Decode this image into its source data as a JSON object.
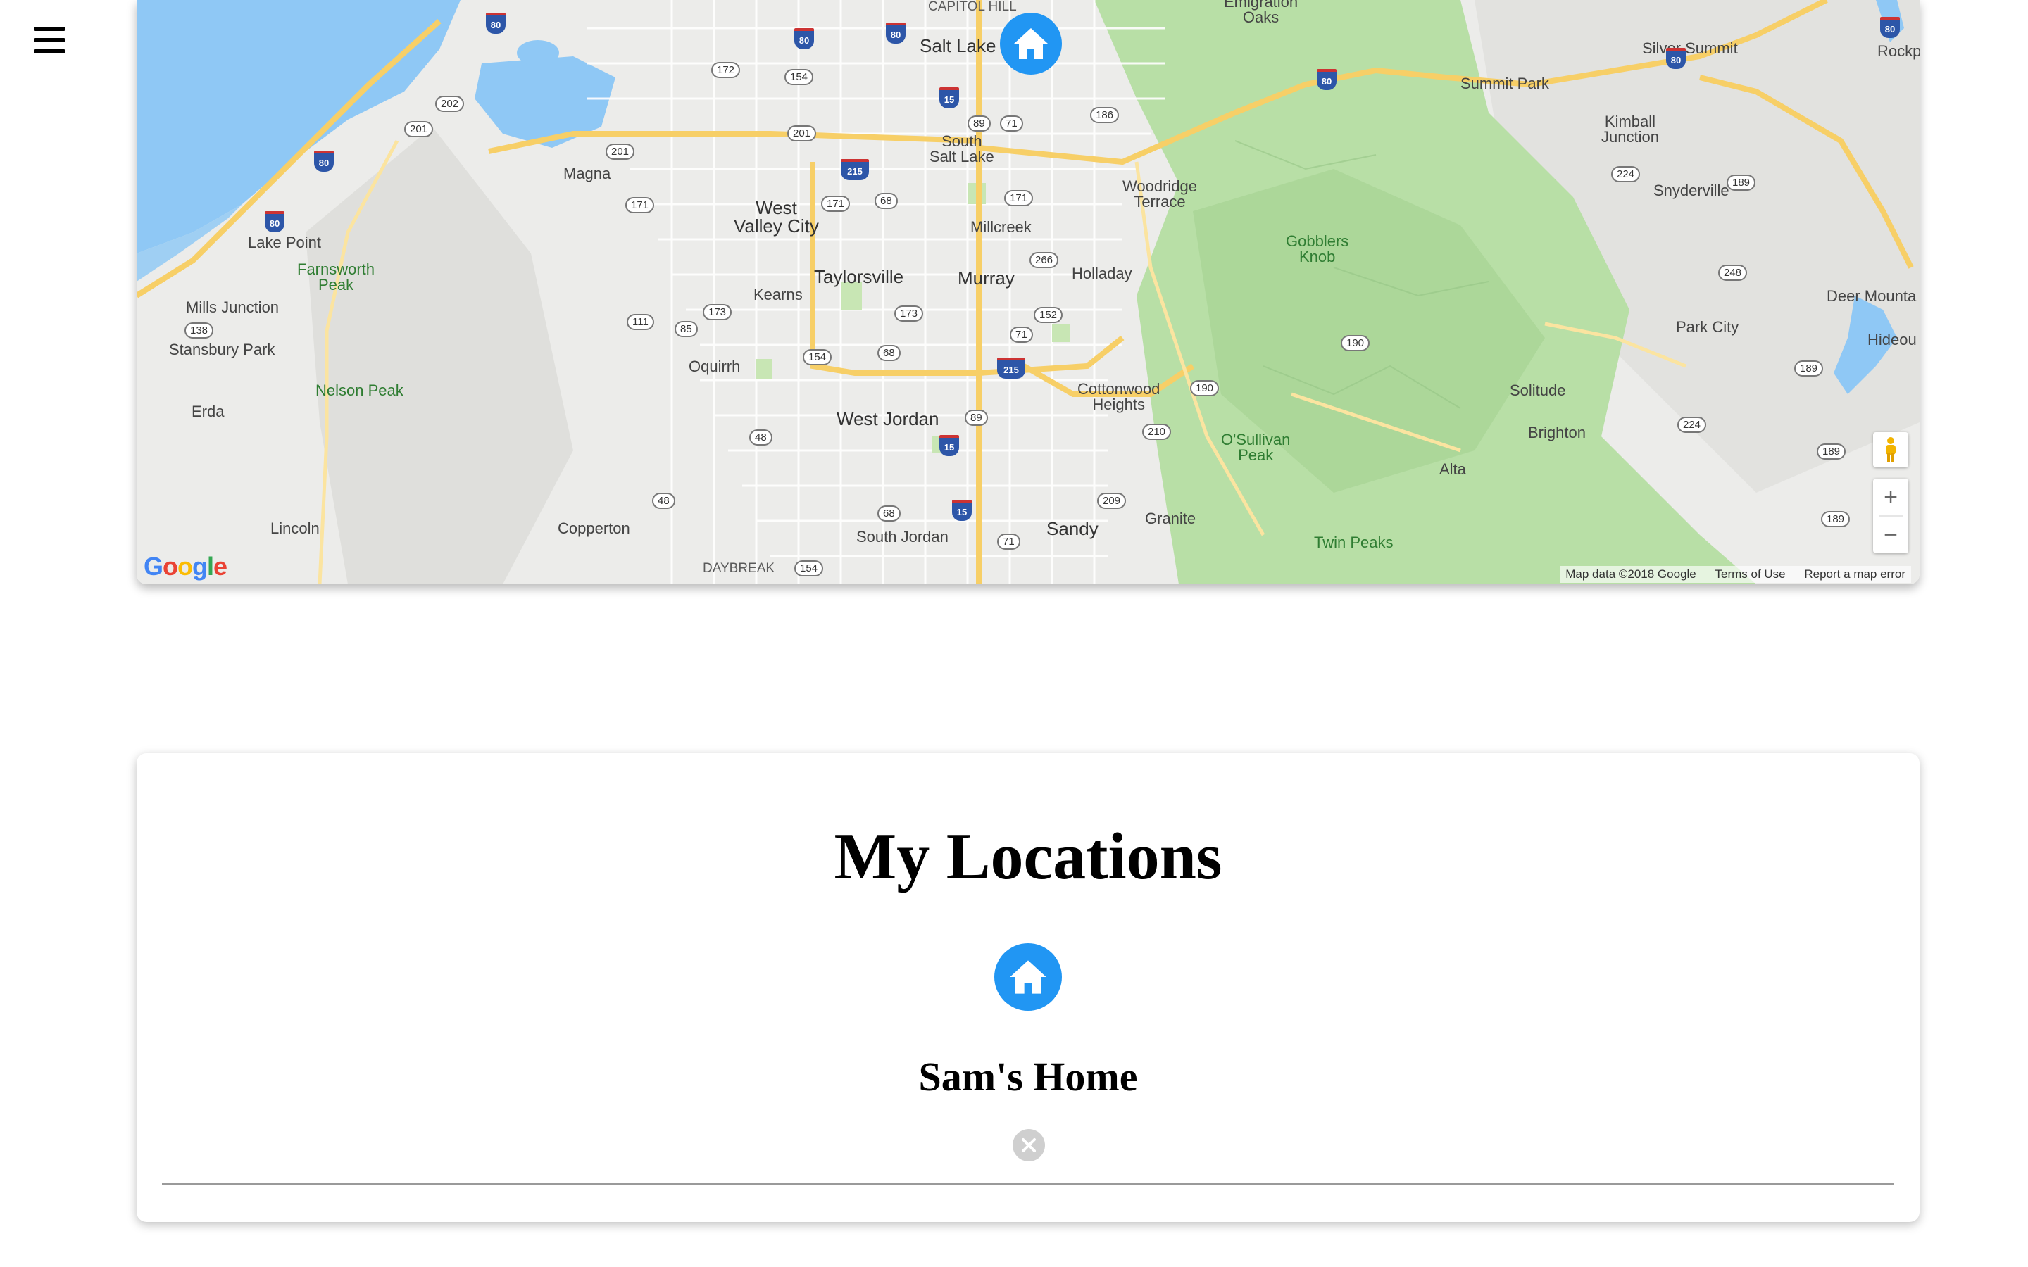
{
  "nav": {
    "menu_icon": "hamburger-menu-icon"
  },
  "map": {
    "cities": {
      "salt_lake": "Salt Lake",
      "south_salt_lake": "South\nSalt Lake",
      "west_valley": "West\nValley City",
      "taylorsville": "Taylorsville",
      "murray": "Murray",
      "millcreek": "Millcreek",
      "holladay": "Holladay",
      "kearns": "Kearns",
      "magna": "Magna",
      "west_jordan": "West Jordan",
      "south_jordan": "South Jordan",
      "sandy": "Sandy",
      "oquirrh": "Oquirrh",
      "copperton": "Copperton",
      "lincoln": "Lincoln",
      "erda": "Erda",
      "lake_point": "Lake Point",
      "mills_junction": "Mills Junction",
      "stansbury_park": "Stansbury Park",
      "cottonwood_heights": "Cottonwood\nHeights",
      "granite": "Granite",
      "alta": "Alta",
      "brighton": "Brighton",
      "solitude": "Solitude",
      "park_city": "Park City",
      "snyderville": "Snyderville",
      "kimball_junction": "Kimball\nJunction",
      "summit_park": "Summit Park",
      "silver_summit": "Silver Summit",
      "woodridge_terrace": "Woodridge\nTerrace",
      "emigration_oaks": "Emigration\nOaks",
      "capitol_hill": "CAPITOL HILL",
      "daybreak": "DAYBREAK",
      "deer_mountain": "Deer Mounta",
      "hideout": "Hideou",
      "rockport": "Rockp"
    },
    "peaks": {
      "farnsworth": "Farnsworth\nPeak",
      "nelson": "Nelson Peak",
      "gobblers": "Gobblers\nKnob",
      "osullivan": "O'Sullivan\nPeak",
      "twin_peaks": "Twin Peaks"
    },
    "google_logo": "Google",
    "footer": {
      "data": "Map data ©2018 Google",
      "terms": "Terms of Use",
      "report": "Report a map error"
    },
    "zoom_in": "+",
    "zoom_out": "−",
    "marker_icon": "home-marker-icon",
    "pegman_icon": "pegman-icon"
  },
  "locations": {
    "title": "My Locations",
    "items": [
      {
        "name": "Sam's Home",
        "icon": "home-icon"
      }
    ],
    "remove_icon": "remove-circle-icon"
  },
  "colors": {
    "accent_blue": "#2196f3",
    "water": "#8fc8f5",
    "park_green": "#b8dfa6",
    "highway": "#f7cf67"
  }
}
